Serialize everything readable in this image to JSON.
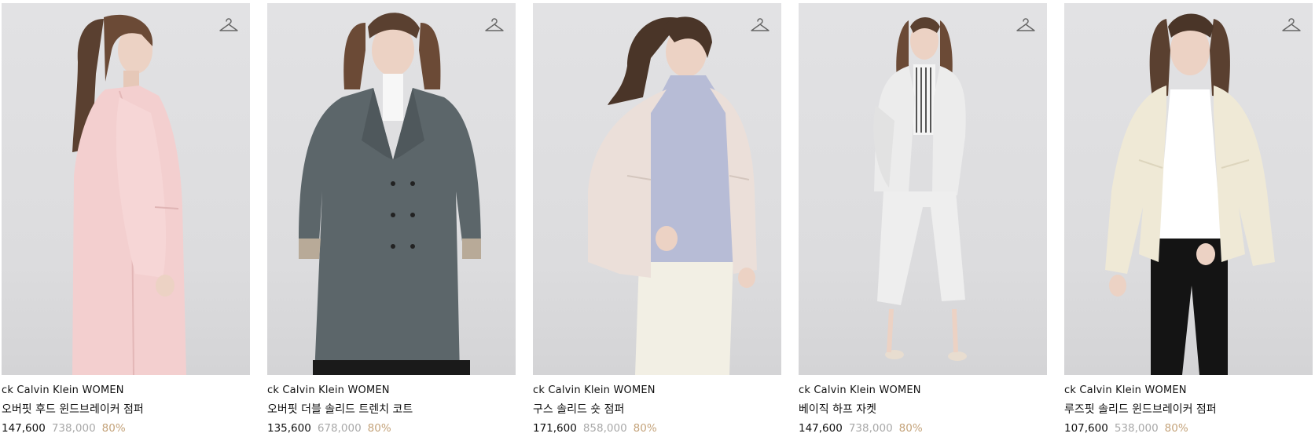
{
  "products": [
    {
      "brand": "ck Calvin Klein WOMEN",
      "name": "오버핏 후드 윈드브레이커 점퍼",
      "sale_price": "147,600",
      "original_price": "738,000",
      "discount": "80%",
      "garment_color": "#f3cfcf",
      "icon": "hanger-icon"
    },
    {
      "brand": "ck Calvin Klein WOMEN",
      "name": "오버핏 더블 솔리드 트렌치 코트",
      "sale_price": "135,600",
      "original_price": "678,000",
      "discount": "80%",
      "garment_color": "#5c666a",
      "icon": "hanger-icon"
    },
    {
      "brand": "ck Calvin Klein WOMEN",
      "name": "구스 솔리드 숏 점퍼",
      "sale_price": "171,600",
      "original_price": "858,000",
      "discount": "80%",
      "garment_color": "#ebdfd9",
      "icon": "hanger-icon"
    },
    {
      "brand": "ck Calvin Klein WOMEN",
      "name": "베이직 하프 자켓",
      "sale_price": "147,600",
      "original_price": "738,000",
      "discount": "80%",
      "garment_color": "#ececec",
      "icon": "hanger-icon"
    },
    {
      "brand": "ck Calvin Klein WOMEN",
      "name": "루즈핏 솔리드 윈드브레이커 점퍼",
      "sale_price": "107,600",
      "original_price": "538,000",
      "discount": "80%",
      "garment_color": "#efe9d6",
      "icon": "hanger-icon"
    }
  ],
  "colors": {
    "discount": "#c4a37a",
    "original_price": "#a8a8a8",
    "photo_background": "#dedee0"
  }
}
